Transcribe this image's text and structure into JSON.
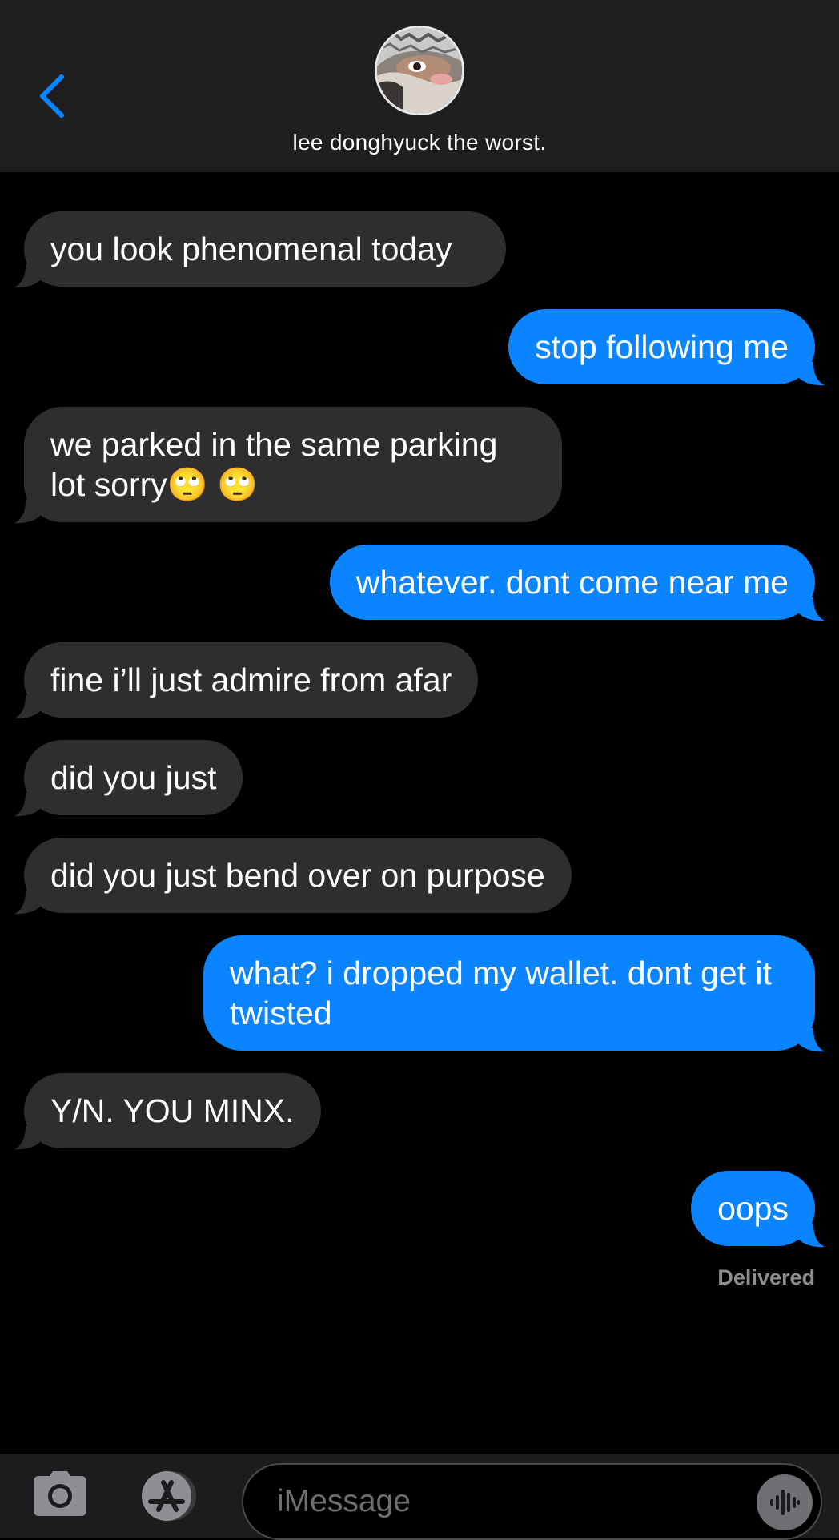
{
  "header": {
    "contact_name": "lee donghyuck the worst.",
    "back_icon": "chevron-left-icon"
  },
  "messages": [
    {
      "direction": "incoming",
      "text": "you look phenomenal today"
    },
    {
      "direction": "outgoing",
      "text": "stop following me"
    },
    {
      "direction": "incoming",
      "text": "we parked in the same parking lot sorry🙄 🙄"
    },
    {
      "direction": "outgoing",
      "text": "whatever. dont come near me"
    },
    {
      "direction": "incoming",
      "text": "fine i’ll just admire from afar"
    },
    {
      "direction": "incoming",
      "text": "did you just"
    },
    {
      "direction": "incoming",
      "text": "did you just bend over on purpose"
    },
    {
      "direction": "outgoing",
      "text": "what? i dropped my wallet. dont get it twisted"
    },
    {
      "direction": "incoming",
      "text": "Y/N. YOU MINX."
    },
    {
      "direction": "outgoing",
      "text": "oops"
    }
  ],
  "status": {
    "delivered": "Delivered"
  },
  "compose": {
    "placeholder": "iMessage",
    "value": ""
  },
  "colors": {
    "outgoing_bubble": "#0a84ff",
    "incoming_bubble": "#2e2e30",
    "header_bg": "#1f1f1f",
    "accent": "#0a84ff"
  },
  "icons": {
    "camera": "camera-icon",
    "apps": "app-store-icon",
    "audio": "audio-waveform-icon"
  }
}
